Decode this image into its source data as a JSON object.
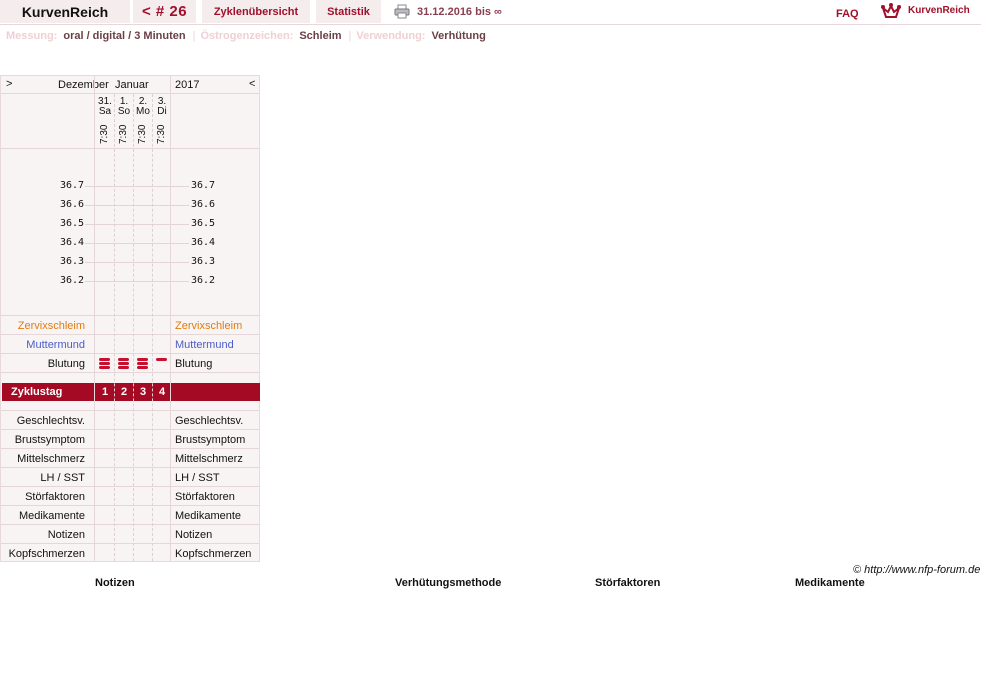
{
  "header": {
    "brand": "KurvenReich",
    "cycle": "< # 26",
    "tab_overview": "Zyklenübersicht",
    "tab_stats": "Statistik",
    "date_range": "31.12.2016 bis ∞",
    "faq": "FAQ",
    "logo_text": "KurvenReich"
  },
  "settings": {
    "measure_label": "Messung:",
    "measure_value": "oral / digital / 3 Minuten",
    "estrogen_label": "Östrogenzeichen:",
    "estrogen_value": "Schleim",
    "use_label": "Verwendung:",
    "use_value": "Verhütung"
  },
  "chart": {
    "nav_prev": ">",
    "nav_next": "<",
    "month_1": "Dezember",
    "month_2": "Januar",
    "year": "2017",
    "days": [
      {
        "num": "31.",
        "wd": "Sa",
        "time": "7:30",
        "cycle_day": "1",
        "bleeding": "heavy"
      },
      {
        "num": "1.",
        "wd": "So",
        "time": "7:30",
        "cycle_day": "2",
        "bleeding": "heavy"
      },
      {
        "num": "2.",
        "wd": "Mo",
        "time": "7:30",
        "cycle_day": "3",
        "bleeding": "heavy"
      },
      {
        "num": "3.",
        "wd": "Di",
        "time": "7:30",
        "cycle_day": "4",
        "bleeding": "light"
      }
    ],
    "temperatures": [
      "36.7",
      "36.6",
      "36.5",
      "36.4",
      "36.3",
      "36.2"
    ],
    "rows_top": {
      "cervix_mucus": "Zervixschleim",
      "cervix": "Muttermund",
      "bleeding": "Blutung"
    },
    "cycle_day_label": "Zyklustag",
    "rows_bottom": [
      "Geschlechtsv.",
      "Brustsymptom",
      "Mittelschmerz",
      "LH / SST",
      "Störfaktoren",
      "Medikamente",
      "Notizen",
      "Kopfschmerzen"
    ],
    "colors": {
      "mucus": "#e07b10",
      "cervix": "#4a5cc8",
      "accent": "#a50a24",
      "bleeding": "#c8102e"
    }
  },
  "footer": {
    "copyright": "© http://www.nfp-forum.de",
    "notes": "Notizen",
    "method": "Verhütungsmethode",
    "disturb": "Störfaktoren",
    "meds": "Medikamente"
  }
}
